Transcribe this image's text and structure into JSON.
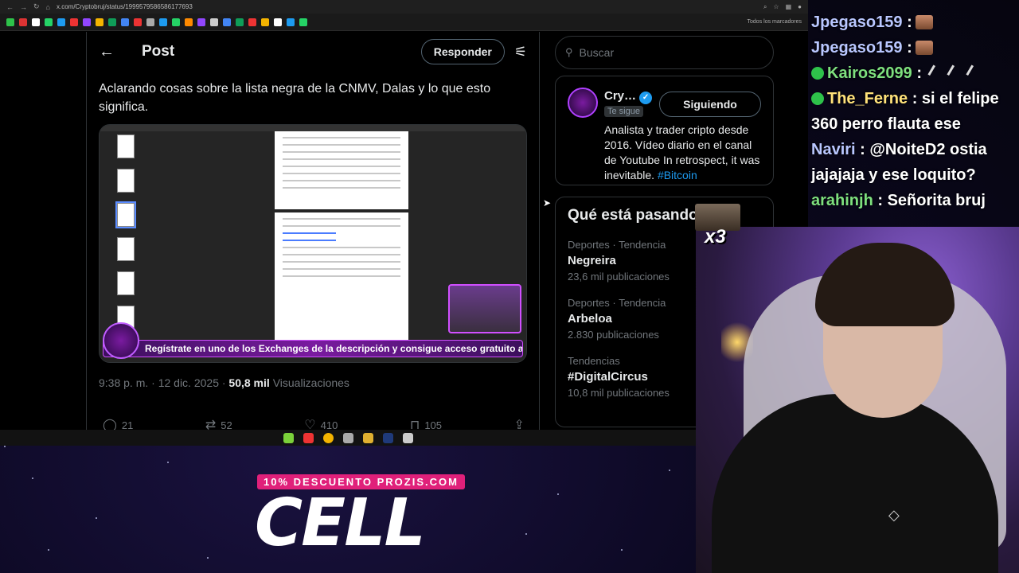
{
  "browser": {
    "url": "x.com/Cryptobruj/status/1999579586586177693",
    "bookmarks_label": "Todos los marcadores"
  },
  "post": {
    "header_title": "Post",
    "reply_label": "Responder",
    "text": "Aclarando cosas sobre la lista negra de la CNMV, Dalas y lo que esto significa.",
    "banner_text": "Regístrate en uno de los Exchanges de la descripción y consigue acceso gratuito a mi cartera SPOT",
    "time": "9:38 p. m. · 12 dic. 2025 ·",
    "views_count": "50,8 mil",
    "views_label": "Visualizaciones",
    "replies": "21",
    "reposts": "52",
    "likes": "410",
    "bookmarks": "105"
  },
  "sidebar": {
    "search_placeholder": "Buscar",
    "profile": {
      "name": "Cry…",
      "follows_you": "Te sigue",
      "follow_label": "Siguiendo",
      "bio": "Analista y trader cripto desde 2016. Vídeo diario en el canal de Youtube In retrospect, it was inevitable.",
      "bio_tag": "#Bitcoin"
    },
    "trends_title": "Qué está pasando",
    "trends": [
      {
        "category": "Deportes · Tendencia",
        "name": "Negreira",
        "count": "23,6 mil publicaciones"
      },
      {
        "category": "Deportes · Tendencia",
        "name": "Arbeloa",
        "count": "2.830 publicaciones"
      },
      {
        "category": "Tendencias",
        "name": "#DigitalCircus",
        "count": "10,8 mil publicaciones"
      }
    ]
  },
  "chat": [
    {
      "user": "Jpegaso159",
      "text": ":"
    },
    {
      "user": "Jpegaso159",
      "text": ":"
    },
    {
      "user": "Kairos2099",
      "text": ":"
    },
    {
      "user": "The_Ferne",
      "text": ": si el felipe 360 perro flauta ese"
    },
    {
      "user": "Naviri",
      "text": ": @NoiteD2 ostia jajajaja y ese loquito?"
    },
    {
      "user": "arahinjh",
      "text": ": Señorita bruj"
    }
  ],
  "meme_multiplier": "x3",
  "sponsor": {
    "pill": "10% DESCUENTO PROZIS.COM",
    "word": "CELL"
  },
  "colors": {
    "accent": "#1d9bf0",
    "stream_purple": "#d04fff",
    "sponsor_pink": "#e0207a"
  }
}
